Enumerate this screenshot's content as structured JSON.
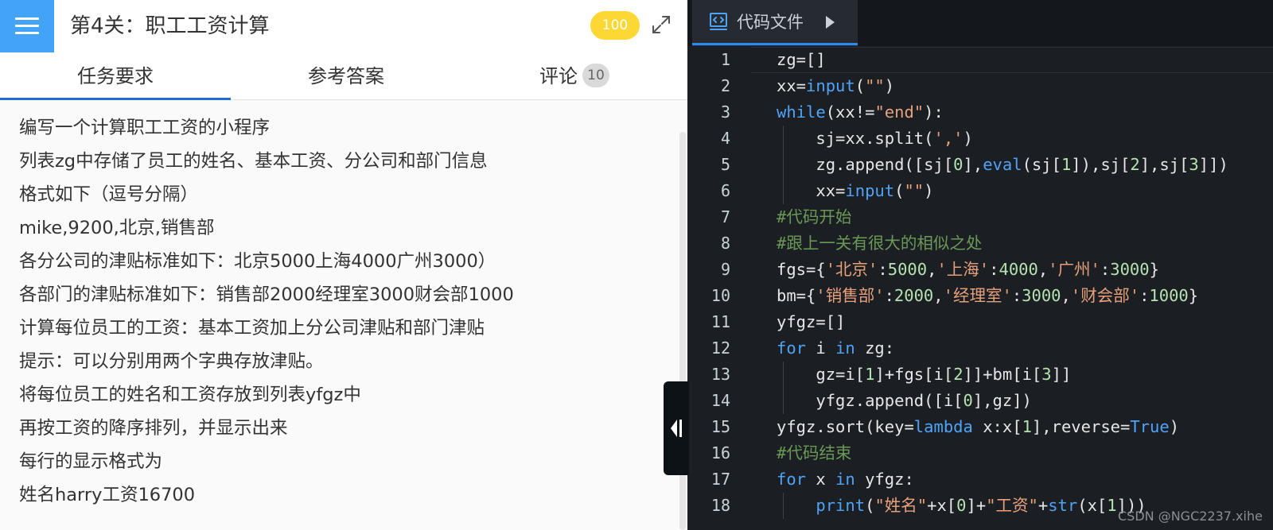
{
  "header": {
    "title": "第4关：职工工资计算",
    "score": "100"
  },
  "tabs": [
    {
      "label": "任务要求"
    },
    {
      "label": "参考答案"
    },
    {
      "label": "评论",
      "count": "10"
    }
  ],
  "task_lines": [
    "编写一个计算职工工资的小程序",
    "列表zg中存储了员工的姓名、基本工资、分公司和部门信息",
    "格式如下（逗号分隔）",
    "mike,9200,北京,销售部",
    "各分公司的津贴标准如下：北京5000上海4000广州3000）",
    "各部门的津贴标准如下：销售部2000经理室3000财会部1000",
    "计算每位员工的工资：基本工资加上分公司津贴和部门津贴",
    "提示：可以分别用两个字典存放津贴。",
    "将每位员工的姓名和工资存放到列表yfgz中",
    "再按工资的降序排列，并显示出来",
    "每行的显示格式为",
    "姓名harry工资16700"
  ],
  "editor": {
    "file_tab_label": "代码文件",
    "line_numbers": [
      "1",
      "2",
      "3",
      "4",
      "5",
      "6",
      "7",
      "8",
      "9",
      "10",
      "11",
      "12",
      "13",
      "14",
      "15",
      "16",
      "17",
      "18"
    ],
    "code_lines": [
      "zg=[]",
      "xx=input(\"\")",
      "while(xx!=\"end\"):",
      "    sj=xx.split(',')",
      "    zg.append([sj[0],eval(sj[1]),sj[2],sj[3]])",
      "    xx=input(\"\")",
      "#代码开始",
      "#跟上一关有很大的相似之处",
      "fgs={'北京':5000,'上海':4000,'广州':3000}",
      "bm={'销售部':2000,'经理室':3000,'财会部':1000}",
      "yfgz=[]",
      "for i in zg:",
      "    gz=i[1]+fgs[i[2]]+bm[i[3]]",
      "    yfgz.append([i[0],gz])",
      "yfgz.sort(key=lambda x:x[1],reverse=True)",
      "#代码结束",
      "for x in yfgz:",
      "    print(\"姓名\"+x[0]+\"工资\"+str(x[1]))"
    ]
  },
  "watermark": "CSDN @NGC2237.xihe",
  "colors": {
    "accent_blue": "#43a3f7",
    "tab_underline": "#1e6ad6",
    "score_badge": "#fdd835",
    "editor_bg": "#1b1f24",
    "keyword": "#4fa3f7",
    "string": "#e8a07a",
    "number": "#b5e3b0",
    "comment": "#6a9955"
  },
  "icons": {
    "menu": "hamburger-menu-icon",
    "expand": "expand-fullscreen-icon",
    "code_file": "code-file-icon",
    "collapse": "collapse-panel-icon"
  }
}
